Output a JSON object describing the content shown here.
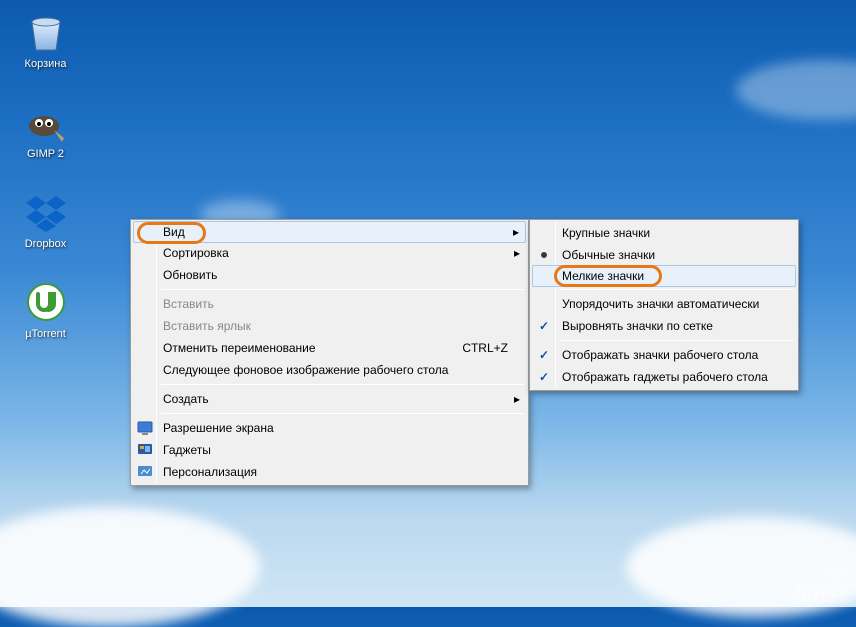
{
  "desktop_icons": [
    {
      "label": "Корзина",
      "name": "recycle-bin"
    },
    {
      "label": "GIMP 2",
      "name": "gimp"
    },
    {
      "label": "Dropbox",
      "name": "dropbox"
    },
    {
      "label": "µTorrent",
      "name": "utorrent"
    }
  ],
  "menu1": {
    "items": [
      {
        "label": "Вид",
        "arrow": true,
        "hover": true
      },
      {
        "label": "Сортировка",
        "arrow": true
      },
      {
        "label": "Обновить"
      }
    ],
    "group2": [
      {
        "label": "Вставить",
        "disabled": true
      },
      {
        "label": "Вставить ярлык",
        "disabled": true
      },
      {
        "label": "Отменить переименование",
        "shortcut": "CTRL+Z"
      },
      {
        "label": "Следующее фоновое изображение рабочего стола"
      }
    ],
    "group3": [
      {
        "label": "Создать",
        "arrow": true
      }
    ],
    "group4": [
      {
        "label": "Разрешение экрана",
        "icon": "screen-res"
      },
      {
        "label": "Гаджеты",
        "icon": "gadgets"
      },
      {
        "label": "Персонализация",
        "icon": "personalize"
      }
    ]
  },
  "menu2": {
    "items": [
      {
        "label": "Крупные значки"
      },
      {
        "label": "Обычные значки",
        "radio": true
      },
      {
        "label": "Мелкие значки",
        "hover": true
      }
    ],
    "group2": [
      {
        "label": "Упорядочить значки автоматически"
      },
      {
        "label": "Выровнять значки по сетке",
        "checked": true
      }
    ],
    "group3": [
      {
        "label": "Отображать значки рабочего стола",
        "checked": true
      },
      {
        "label": "Отображать гаджеты  рабочего стола",
        "checked": true
      }
    ]
  },
  "watermark": {
    "line1": "club",
    "line2": "Sovet"
  }
}
